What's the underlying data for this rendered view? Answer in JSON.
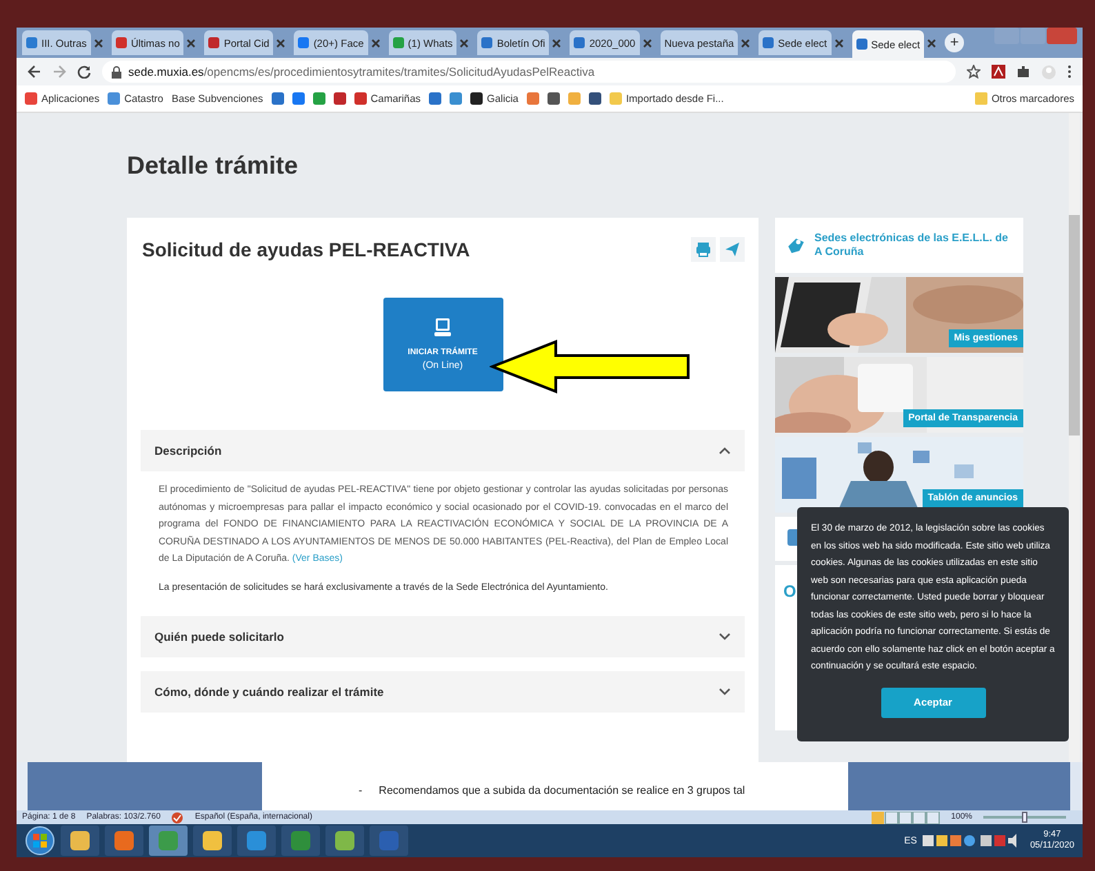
{
  "browser": {
    "tabs": [
      {
        "title": "III. Outras",
        "color": "#2b7bd0",
        "selected": false
      },
      {
        "title": "Últimas no",
        "color": "#d0302b",
        "selected": false
      },
      {
        "title": "Portal Cid",
        "color": "#c0282b",
        "selected": false
      },
      {
        "title": "(20+) Face",
        "color": "#1877f2",
        "selected": false
      },
      {
        "title": "(1) Whats",
        "color": "#25a244",
        "selected": false
      },
      {
        "title": "Boletín Ofi",
        "color": "#2a72c8",
        "selected": false
      },
      {
        "title": "2020_000",
        "color": "#2a72c8",
        "selected": false
      },
      {
        "title": "Nueva pestaña",
        "selected": false
      },
      {
        "title": "Sede elect",
        "color": "#2a72c8",
        "selected": false
      },
      {
        "title": "Sede elect",
        "color": "#2a72c8",
        "selected": true
      }
    ],
    "new_tab": "+",
    "url": {
      "host": "sede.muxia.es",
      "path": "/opencms/es/procedimientosytramites/tramites/SolicitudAyudasPelReactiva"
    },
    "bookmarks": [
      {
        "label": "Aplicaciones",
        "color": "#e8453c"
      },
      {
        "label": "Catastro",
        "color": "#4a90d9"
      },
      {
        "label": "Base Subvenciones"
      },
      {
        "color": "#2a72c8"
      },
      {
        "color": "#1877f2"
      },
      {
        "color": "#25a244"
      },
      {
        "color": "#c0282b"
      },
      {
        "label": "Camariñas",
        "color": "#d0302b"
      },
      {
        "color": "#2a72c8"
      },
      {
        "color": "#3a8fd0"
      },
      {
        "label": "Galicia",
        "color": "#222222"
      },
      {
        "color": "#e8763c"
      },
      {
        "color": "#555555"
      },
      {
        "color": "#f0b040"
      },
      {
        "color": "#34507a"
      },
      {
        "label": "Importado desde Fi...",
        "color": "#f2c94c"
      }
    ],
    "other_bookmarks": "Otros marcadores"
  },
  "page": {
    "heading": "Detalle trámite",
    "title": "Solicitud de ayudas PEL-REACTIVA",
    "start_button": {
      "label": "INICIAR TRÁMITE",
      "sublabel": "(On Line)"
    },
    "sections": [
      {
        "title": "Descripción",
        "expanded": true,
        "paragraphs": [
          {
            "text": "El procedimiento de \"Solicitud de ayudas PEL-REACTIVA\" tiene por objeto gestionar y controlar las ayudas solicitadas por personas autónomas y microempresas para pallar el impacto económico y social ocasionado por el COVID-19. convocadas en el marco del programa del FONDO DE FINANCIAMIENTO PARA LA REACTIVACIÓN ECONÓMICA Y SOCIAL DE LA PROVINCIA DE A CORUÑA DESTINADO A LOS AYUNTAMIENTOS DE MENOS DE 50.000 HABITANTES (PEL-Reactiva), del Plan de Empleo Local de La Diputación de A Coruña.",
            "link": "(Ver Bases)"
          },
          {
            "text": "La presentación de solicitudes se hará exclusivamente a través de la Sede Electrónica del Ayuntamiento."
          }
        ]
      },
      {
        "title": "Quién puede solicitarlo",
        "expanded": false
      },
      {
        "title": "Cómo, dónde y cuándo realizar el trámite",
        "expanded": false
      }
    ],
    "sidebar": {
      "portal_link": "Sedes electrónicas de las E.E.L.L. de A Coruña",
      "tiles": [
        {
          "label": "Mis gestiones",
          "kind": "picture"
        },
        {
          "label": "Portal de Transparencia",
          "kind": "picture"
        },
        {
          "label": "Tablón de anuncios",
          "kind": "picture"
        }
      ],
      "heading": "O"
    },
    "cookie_notice": {
      "text": "El 30 de marzo de 2012, la legislación sobre las cookies en los sitios web ha sido modificada. Este sitio web utiliza cookies. Algunas de las cookies utilizadas en este sitio web son necesarias para que esta aplicación pueda funcionar correctamente. Usted puede borrar y bloquear todas las cookies de este sitio web, pero si lo hace la aplicación podría no funcionar correctamente. Si estás de acuerdo con ello solamente haz click en el botón aceptar a continuación y se ocultará este espacio.",
      "button": "Aceptar"
    }
  },
  "document": {
    "line": "Recomendamos que a subida da documentación se realice en 3 grupos tal",
    "bullet": "-"
  },
  "status_bar": {
    "page": "Página: 1 de 8",
    "words": "Palabras: 103/2.760",
    "language": "Español (España, internacional)",
    "zoom": "100%",
    "zoom_slider": {
      "level": 0.5
    }
  },
  "taskbar": {
    "apps": [
      {
        "color": "#e8b84a",
        "selected": false
      },
      {
        "color": "#e86a1e",
        "selected": false
      },
      {
        "color": "#3c9b4a",
        "selected": true
      },
      {
        "color": "#f0c040",
        "selected": false
      },
      {
        "color": "#2a8fd8",
        "selected": false
      },
      {
        "color": "#2f8f3c",
        "selected": false
      },
      {
        "color": "#7fb848",
        "selected": false
      },
      {
        "color": "#2b5fb0",
        "selected": false
      }
    ],
    "language": "ES",
    "time": "9:47",
    "date": "05/11/2020"
  }
}
